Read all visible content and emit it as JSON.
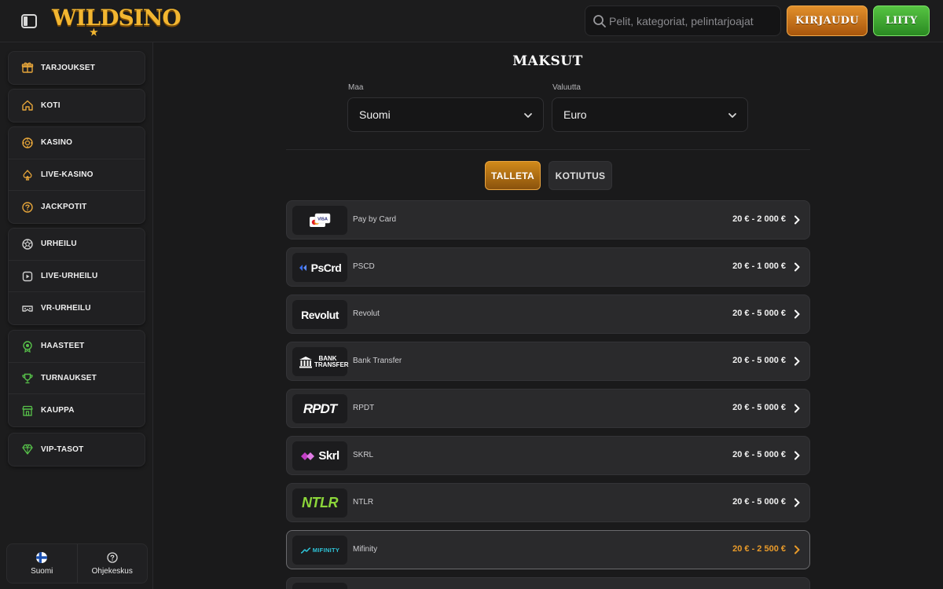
{
  "header": {
    "brand": "WILDSINO",
    "search_placeholder": "Pelit, kategoriat, pelintarjoajat",
    "login_label": "KIRJAUDU",
    "join_label": "LIITY"
  },
  "sidebar": {
    "groups": [
      [
        {
          "label": "TARJOUKSET",
          "icon": "gift-icon"
        }
      ],
      [
        {
          "label": "KOTI",
          "icon": "home-icon"
        }
      ],
      [
        {
          "label": "KASINO",
          "icon": "casino-chip-icon"
        },
        {
          "label": "LIVE-KASINO",
          "icon": "spade-icon"
        },
        {
          "label": "JACKPOTIT",
          "icon": "jackpot-icon"
        }
      ],
      [
        {
          "label": "URHEILU",
          "icon": "ball-icon"
        },
        {
          "label": "LIVE-URHEILU",
          "icon": "play-screen-icon"
        },
        {
          "label": "VR-URHEILU",
          "icon": "vr-headset-icon"
        }
      ],
      [
        {
          "label": "HAASTEET",
          "icon": "badge-icon"
        },
        {
          "label": "TURNAUKSET",
          "icon": "trophy-icon"
        },
        {
          "label": "KAUPPA",
          "icon": "shop-icon"
        }
      ],
      [
        {
          "label": "VIP-TASOT",
          "icon": "diamond-icon"
        }
      ]
    ],
    "bottom": {
      "language_label": "Suomi",
      "help_label": "Ohjekeskus"
    }
  },
  "main": {
    "title": "MAKSUT",
    "country": {
      "label": "Maa",
      "value": "Suomi"
    },
    "currency": {
      "label": "Valuutta",
      "value": "Euro"
    },
    "tabs": {
      "deposit": "TALLETA",
      "withdraw": "KOTIUTUS"
    },
    "methods": [
      {
        "logo": "VISA",
        "name": "Pay by Card",
        "range": "20 € - 2 000 €"
      },
      {
        "logo": "PsCrd",
        "name": "PSCD",
        "range": "20 € - 1 000 €"
      },
      {
        "logo": "Revolut",
        "name": "Revolut",
        "range": "20 € - 5 000 €"
      },
      {
        "logo": "BANK TRANSFER",
        "name": "Bank Transfer",
        "range": "20 € - 5 000 €"
      },
      {
        "logo": "RPDT",
        "name": "RPDT",
        "range": "20 € - 5 000 €"
      },
      {
        "logo": "Skrl",
        "name": "SKRL",
        "range": "20 € - 5 000 €"
      },
      {
        "logo": "NTLR",
        "name": "NTLR",
        "range": "20 € - 5 000 €"
      },
      {
        "logo": "MIFINITY",
        "name": "Mifinity",
        "range": "20 € - 2 500 €"
      }
    ]
  },
  "colors": {
    "accent_orange": "#e89a2a",
    "accent_green": "#3aa32e",
    "background": "#1a1a1b"
  }
}
